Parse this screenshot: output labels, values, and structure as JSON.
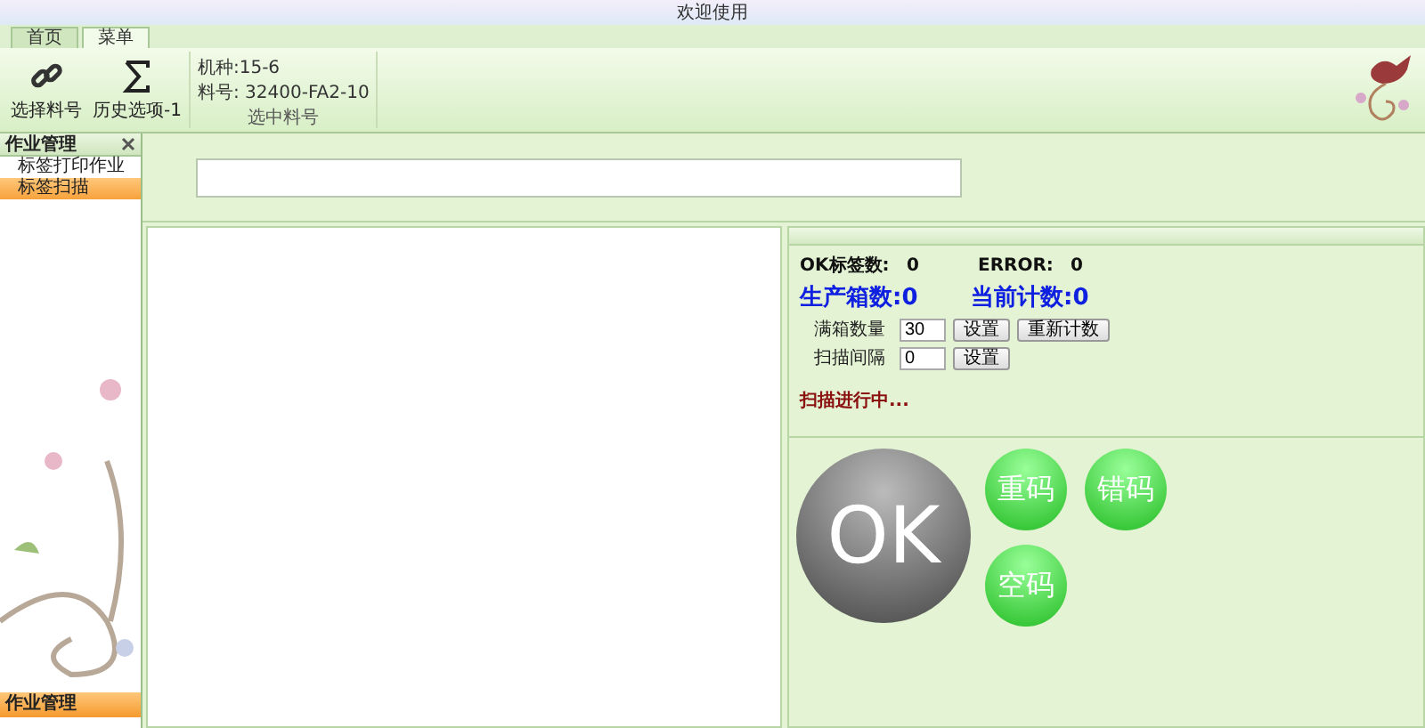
{
  "window": {
    "title": "欢迎使用"
  },
  "tabs": [
    {
      "label": "首页",
      "selected": false
    },
    {
      "label": "菜单",
      "selected": true
    }
  ],
  "ribbon": {
    "buttons": [
      {
        "kind": "link",
        "label": "选择料号"
      },
      {
        "kind": "sigma",
        "label": "历史选项-1"
      }
    ],
    "group": {
      "lines": [
        "机种:15-6",
        "料号: 32400-FA2-10"
      ],
      "caption": "选中料号"
    }
  },
  "sidebar": {
    "title": "作业管理",
    "items": [
      {
        "label": "标签打印作业",
        "selected": false
      },
      {
        "label": "标签扫描",
        "selected": true
      }
    ],
    "footer": "作业管理"
  },
  "stats": {
    "ok_label": "OK标签数:",
    "ok_value": "0",
    "error_label": "ERROR:",
    "error_value": "0",
    "boxes": "生产箱数:0",
    "count": "当前计数:0"
  },
  "settings": [
    {
      "label": "满箱数量",
      "value": "30",
      "buttons": [
        "设置",
        "重新计数"
      ]
    },
    {
      "label": "扫描间隔",
      "value": "0",
      "buttons": [
        "设置"
      ]
    }
  ],
  "status": "扫描进行中...",
  "indicators": [
    {
      "kind": "big",
      "label": "OK",
      "on": false
    },
    {
      "kind": "small",
      "label": "重码",
      "on": true
    },
    {
      "kind": "small",
      "label": "错码",
      "on": true
    },
    {
      "kind": "small",
      "label": "空码",
      "on": true
    }
  ]
}
